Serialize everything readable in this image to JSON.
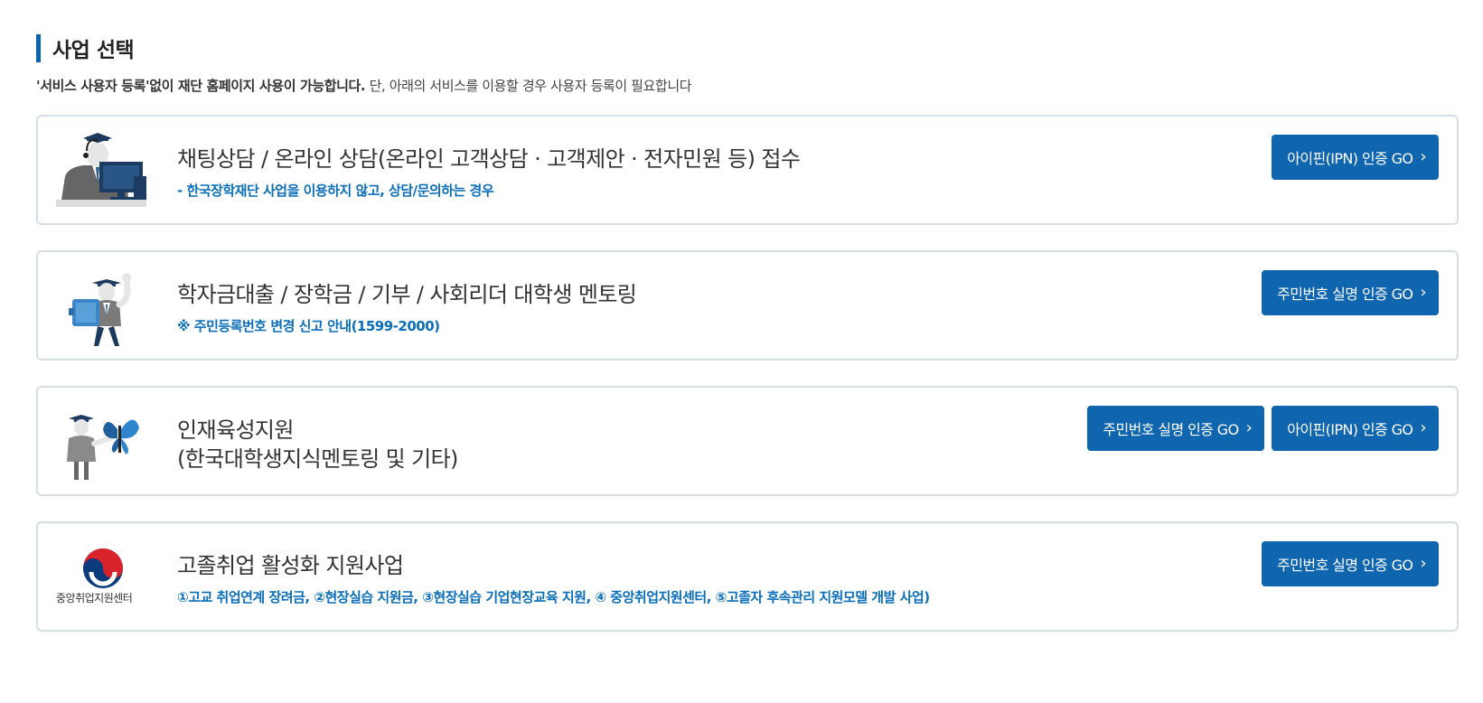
{
  "header": {
    "title": "사업 선택",
    "notice_bold": "'서비스 사용자 등록'없이 재단 홈페이지 사용이 가능합니다.",
    "notice_rest": " 단, 아래의 서비스를 이용할 경우 사용자 등록이 필요합니다"
  },
  "cards": [
    {
      "icon": "counselor-icon",
      "title": "채팅상담 / 온라인 상담(온라인 고객상담 · 고객제안 · 전자민원 등) 접수",
      "sub": "- 한국장학재단 사업을 이용하지 않고, 상담/문의하는 경우",
      "buttons": [
        "아이핀(IPN) 인증 GO"
      ]
    },
    {
      "icon": "graduate-with-book-icon",
      "title": "학자금대출 / 장학금 / 기부 / 사회리더 대학생 멘토링",
      "sub": "※ 주민등록번호 변경 신고 안내(1599-2000)",
      "buttons": [
        "주민번호 실명 인증 GO"
      ]
    },
    {
      "icon": "graduate-butterfly-icon",
      "title": "인재육성지원",
      "title2": "(한국대학생지식멘토링 및 기타)",
      "buttons": [
        "주민번호 실명 인증 GO",
        "아이핀(IPN) 인증 GO"
      ]
    },
    {
      "icon": "taegeuk-logo-icon",
      "logo_text": "중앙취업지원센터",
      "title": "고졸취업 활성화 지원사업",
      "sub": "①고교 취업연계 장려금, ②현장실습 지원금, ③현장실습 기업현장교육 지원, ④ 중앙취업지원센터, ⑤고졸자 후속관리 지원모델 개발 사업)",
      "buttons": [
        "주민번호 실명 인증 GO"
      ]
    }
  ],
  "colors": {
    "accent": "#0f65ae",
    "border": "#d3dee6",
    "sub_text": "#0a6eb8"
  },
  "chevron": "›"
}
